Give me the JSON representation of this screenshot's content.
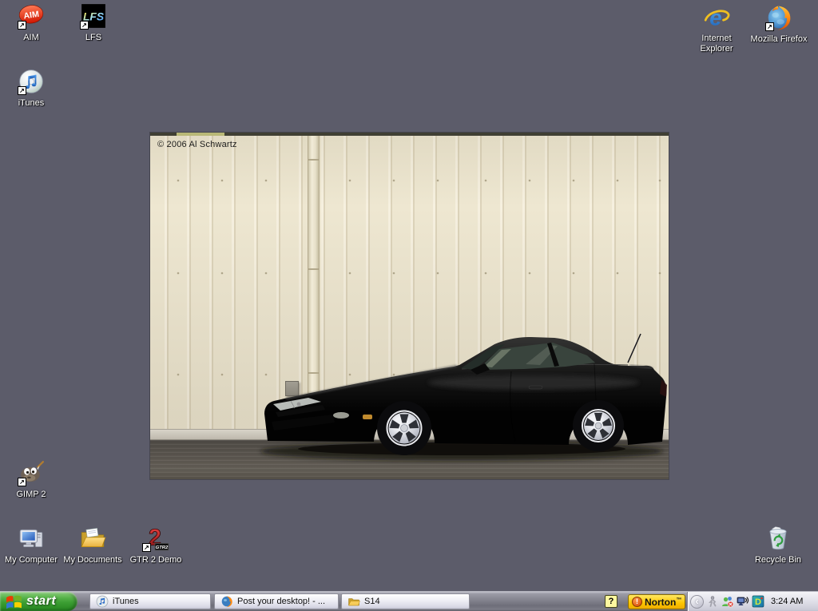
{
  "desktop": {
    "background_color": "#5c5c6a",
    "shortcut_arrow": "↗",
    "icons": [
      {
        "label": "AIM"
      },
      {
        "label": "LFS"
      },
      {
        "label": "iTunes"
      },
      {
        "label": "Internet Explorer"
      },
      {
        "label": "Mozilla Firefox"
      },
      {
        "label": "GIMP 2"
      },
      {
        "label": "My Computer"
      },
      {
        "label": "My Documents"
      },
      {
        "label": "GTR 2 Demo"
      },
      {
        "label": "Recycle Bin"
      }
    ]
  },
  "wallpaper": {
    "credit": "© 2006 Al Schwartz",
    "wall_color": "#eee7d1",
    "asphalt_color": "#55504a",
    "car_color": "#0a0a0a"
  },
  "taskbar": {
    "start_label": "start",
    "buttons": [
      {
        "label": "iTunes"
      },
      {
        "label": "Post your desktop! - ..."
      },
      {
        "label": "S14"
      }
    ],
    "tray": {
      "help_glyph": "?",
      "norton_label": "Norton",
      "norton_tm": "™",
      "chevron_glyph": "‹",
      "clock": "3:24 AM"
    },
    "colors": {
      "start_green": "#3c9e33",
      "norton_yellow": "#fdc500",
      "taskbar_silver": "#82828d"
    }
  },
  "icon_glyphs": {
    "aim": "AIM",
    "lfs": "LFS",
    "ie": "e",
    "gtr_numeral": "2",
    "gtr_tag": "GTR2",
    "daemon": "D"
  }
}
